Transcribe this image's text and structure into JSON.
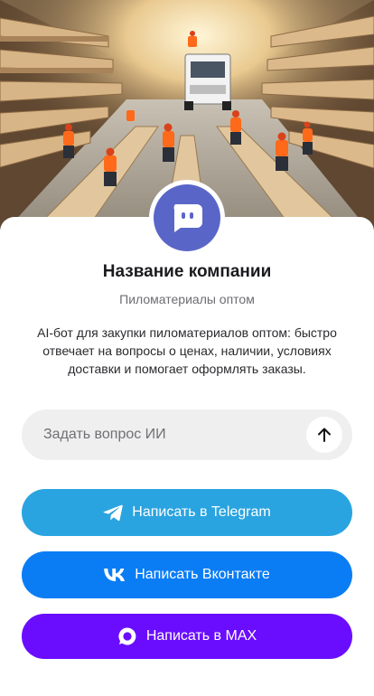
{
  "hero": {
    "image": "lumber-warehouse-workers-photo"
  },
  "profile": {
    "avatar_icon": "chat-bot-icon",
    "avatar_color": "#5a66c7",
    "name": "Название компании",
    "subtitle": "Пиломатериалы оптом",
    "description": "AI-бот для закупки пиломатериалов оптом: быстро отвечает на вопросы о ценах, наличии, условиях доставки и помогает оформлять заказы."
  },
  "ask": {
    "placeholder": "Задать вопрос ИИ",
    "value": "",
    "send_icon": "arrow-up-icon"
  },
  "buttons": {
    "telegram": {
      "label": "Написать в Telegram",
      "icon": "telegram-icon",
      "color": "#2aa4e0"
    },
    "vk": {
      "label": "Написать Вконтакте",
      "icon": "vk-icon",
      "color": "#0a7df5"
    },
    "max": {
      "label": "Написать в MAX",
      "icon": "max-icon",
      "color": "#6a0dff"
    }
  }
}
